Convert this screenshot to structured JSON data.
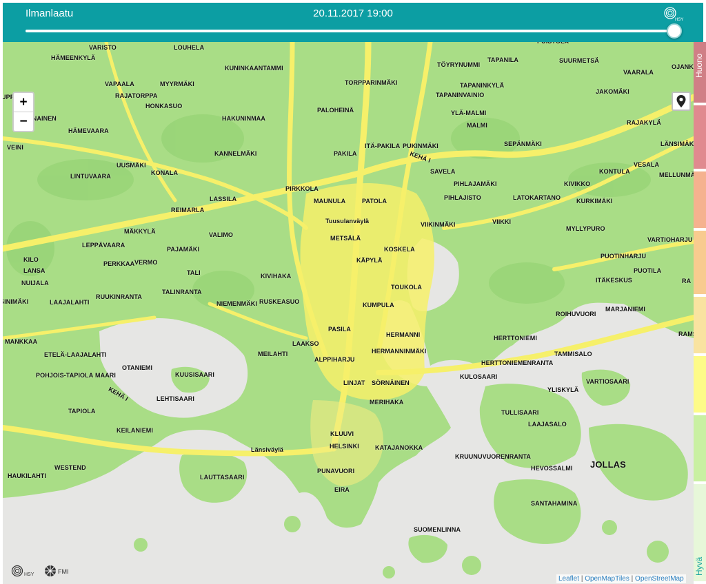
{
  "header": {
    "title": "Ilmanlaatu",
    "timestamp": "20.11.2017 19:00",
    "logo_label": "HSY",
    "time_slider": {
      "position": 1.0
    }
  },
  "map": {
    "zoom_in_label": "+",
    "zoom_out_label": "−",
    "colors": {
      "water": "#e6e6e4",
      "land": "#a9dd86",
      "roads": "#f6f06a"
    },
    "places": [
      {
        "name": "VARISTO"
      },
      {
        "name": "LOUHELA"
      },
      {
        "name": "PUISTOLA"
      },
      {
        "name": "HÄMEENKYLÄ"
      },
      {
        "name": "KUNINKAANTAMMI"
      },
      {
        "name": "TÖYRYNUMMI"
      },
      {
        "name": "TAPANILA"
      },
      {
        "name": "SUURMETSÄ"
      },
      {
        "name": "VAARALA"
      },
      {
        "name": "OJANKO"
      },
      {
        "name": "VAPAALA"
      },
      {
        "name": "MYYRMÄKI"
      },
      {
        "name": "TORPPARINMÄKI"
      },
      {
        "name": "TAPANINKYLÄ"
      },
      {
        "name": "RAJATORPPA"
      },
      {
        "name": "JAKOMÄKI"
      },
      {
        "name": "UPPERI"
      },
      {
        "name": "HONKASUO"
      },
      {
        "name": "TAPANINVAINIO"
      },
      {
        "name": "PALOHEINÄ"
      },
      {
        "name": "YLÄ-MALMI"
      },
      {
        "name": "LINNAINEN"
      },
      {
        "name": "HAKUNINMAA"
      },
      {
        "name": "RAJAKYLÄ"
      },
      {
        "name": "MALMI"
      },
      {
        "name": "HÄMEVAARA"
      },
      {
        "name": "SEPÄNMÄKI"
      },
      {
        "name": "LÄNSIMÄKI"
      },
      {
        "name": "VEINI"
      },
      {
        "name": "KANNELMÄKI"
      },
      {
        "name": "PAKILA"
      },
      {
        "name": "ITÄ-PAKILA"
      },
      {
        "name": "PUKINMÄKI"
      },
      {
        "name": "KEHÄ I"
      },
      {
        "name": "UUSMÄKI"
      },
      {
        "name": "VESALA"
      },
      {
        "name": "KONALA"
      },
      {
        "name": "SAVELA"
      },
      {
        "name": "KONTULA"
      },
      {
        "name": "LINTUVAARA"
      },
      {
        "name": "MELLUNMÄKI"
      },
      {
        "name": "PIHLAJAMÄKI"
      },
      {
        "name": "KIVIKKO"
      },
      {
        "name": "PIRKKOLA"
      },
      {
        "name": "LASSILA"
      },
      {
        "name": "MAUNULA"
      },
      {
        "name": "PATOLA"
      },
      {
        "name": "PIHLAJISTO"
      },
      {
        "name": "LATOKARTANO"
      },
      {
        "name": "KURKIMÄKI"
      },
      {
        "name": "REIMARLA"
      },
      {
        "name": "Tuusulanväylä"
      },
      {
        "name": "VIIKINMÄKI"
      },
      {
        "name": "VIIKKI"
      },
      {
        "name": "MÄKKYLÄ"
      },
      {
        "name": "MYLLYPURO"
      },
      {
        "name": "VALIMO"
      },
      {
        "name": "METSÄLÄ"
      },
      {
        "name": "VARTIOHARJU"
      },
      {
        "name": "LEPPÄVAARA"
      },
      {
        "name": "PAJAMÄKI"
      },
      {
        "name": "KOSKELA"
      },
      {
        "name": "KILO"
      },
      {
        "name": "PERKKAA"
      },
      {
        "name": "VERMO"
      },
      {
        "name": "KÄPYLÄ"
      },
      {
        "name": "PUOTINHARJU"
      },
      {
        "name": "LANSA"
      },
      {
        "name": "TALI"
      },
      {
        "name": "PUOTILA"
      },
      {
        "name": "KIVIHAKA"
      },
      {
        "name": "NUIJALA"
      },
      {
        "name": "ITÄKESKUS"
      },
      {
        "name": "RA"
      },
      {
        "name": "TOUKOLA"
      },
      {
        "name": "TALINRANTA"
      },
      {
        "name": "SINIMÄKI"
      },
      {
        "name": "RUUKINRANTA"
      },
      {
        "name": "NIEMENMÄKI"
      },
      {
        "name": "RUSKEASUO"
      },
      {
        "name": "KUMPULA"
      },
      {
        "name": "MARJANIEMI"
      },
      {
        "name": "LAAJALAHTI"
      },
      {
        "name": "ROIHUVUORI"
      },
      {
        "name": "PASILA"
      },
      {
        "name": "RAMSINI"
      },
      {
        "name": "MANKKAA"
      },
      {
        "name": "HERMANNI"
      },
      {
        "name": "HERTTONIEMI"
      },
      {
        "name": "LAAKSO"
      },
      {
        "name": "ETELÄ-LAAJALAHTI"
      },
      {
        "name": "MEILAHTI"
      },
      {
        "name": "HERMANNINMÄKI"
      },
      {
        "name": "TAMMISALO"
      },
      {
        "name": "ALPPIHARJU"
      },
      {
        "name": "HERTTONIEMENRANTA"
      },
      {
        "name": "OTANIEMI"
      },
      {
        "name": "POHJOIS-TAPIOLA"
      },
      {
        "name": "MAARI"
      },
      {
        "name": "KUUSISAARI"
      },
      {
        "name": "KULOSAARI"
      },
      {
        "name": "VARTIOSAARI"
      },
      {
        "name": "LINJAT"
      },
      {
        "name": "SÖRNÄINEN"
      },
      {
        "name": "KEHÄ I"
      },
      {
        "name": "YLISKYLÄ"
      },
      {
        "name": "LEHTISAARI"
      },
      {
        "name": "MERIHAKA"
      },
      {
        "name": "TAPIOLA"
      },
      {
        "name": "TULLISAARI"
      },
      {
        "name": "LAAJASALO"
      },
      {
        "name": "KEILANIEMI"
      },
      {
        "name": "KLUUVI"
      },
      {
        "name": "HELSINKI"
      },
      {
        "name": "KATAJANOKKA"
      },
      {
        "name": "Länsiväylä"
      },
      {
        "name": "KRUUNUVUORENRANTA"
      },
      {
        "name": "JOLLAS"
      },
      {
        "name": "WESTEND"
      },
      {
        "name": "HEVOSSALMI"
      },
      {
        "name": "PUNAVUORI"
      },
      {
        "name": "HAUKILAHTI"
      },
      {
        "name": "LAUTTASAARI"
      },
      {
        "name": "EIRA"
      },
      {
        "name": "SANTAHAMINA"
      },
      {
        "name": "SUOMENLINNA"
      }
    ],
    "attribution": {
      "leaflet": "Leaflet",
      "openmaptiles": "OpenMapTiles",
      "openstreetmap": "OpenStreetMap",
      "separator": "|"
    },
    "bottom_logos": {
      "hsy": "HSY",
      "fmi": "FMI"
    }
  },
  "legend": {
    "top_label": "Huono",
    "bottom_label": "Hyvä",
    "colors": [
      "#d07f86",
      "#e08a8f",
      "#f5b28f",
      "#f8cb8f",
      "#f9e3a0",
      "#fdfb88",
      "#c9f0a2",
      "#e7f7d9"
    ]
  }
}
